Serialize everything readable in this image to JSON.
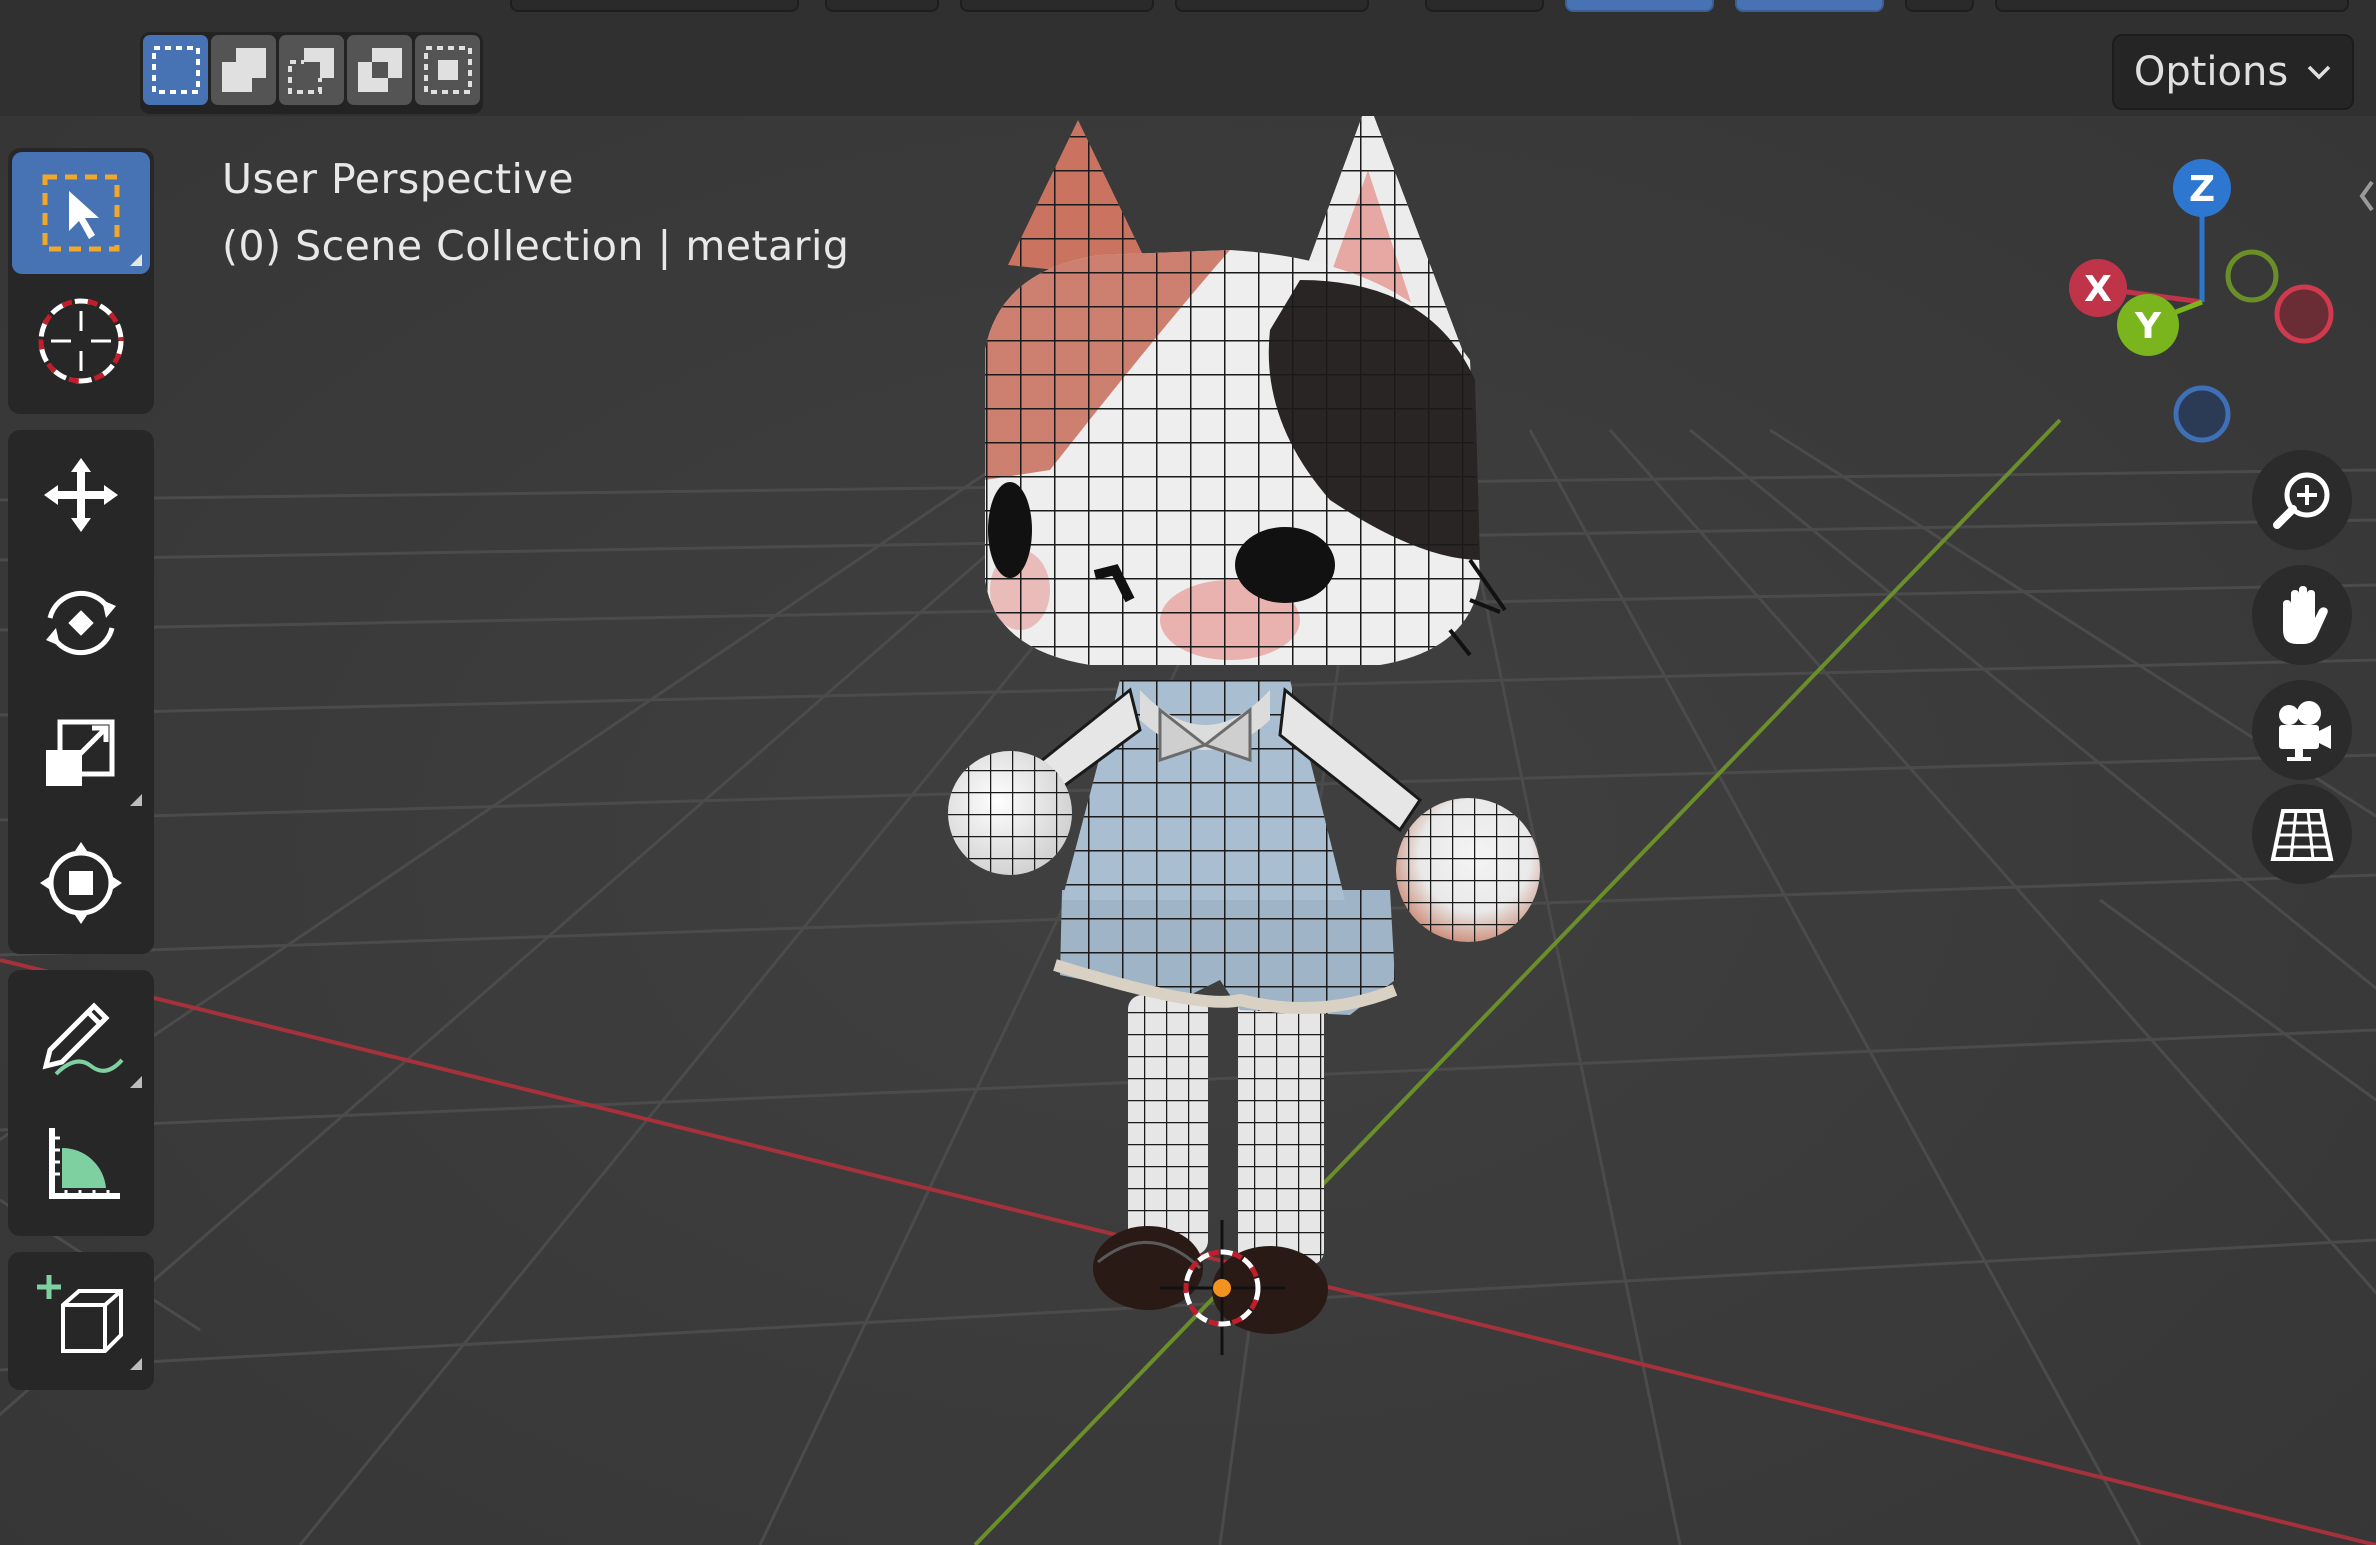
{
  "viewport": {
    "overlay_line1": "User Perspective",
    "overlay_line2": "(0) Scene Collection | metarig",
    "options_label": "Options",
    "background_color": "#3d3d3d",
    "grid_color": "#4a4a4a",
    "x_axis_color": "#a5313b",
    "y_axis_color": "#6a8f2a"
  },
  "select_modes": [
    {
      "name": "new-selection-icon",
      "active": true
    },
    {
      "name": "extend-selection-icon",
      "active": false
    },
    {
      "name": "subtract-selection-icon",
      "active": false
    },
    {
      "name": "invert-selection-icon",
      "active": false
    },
    {
      "name": "intersect-selection-icon",
      "active": false
    }
  ],
  "tools": [
    {
      "name": "select-box-icon",
      "active": true
    },
    {
      "name": "cursor-icon",
      "active": false
    },
    {
      "name": "move-icon",
      "active": false
    },
    {
      "name": "rotate-icon",
      "active": false
    },
    {
      "name": "scale-icon",
      "active": false
    },
    {
      "name": "transform-icon",
      "active": false
    },
    {
      "name": "annotate-icon",
      "active": false
    },
    {
      "name": "measure-icon",
      "active": false
    },
    {
      "name": "add-cube-icon",
      "active": false
    }
  ],
  "gizmo": {
    "z_label": "Z",
    "x_label": "X",
    "y_label": "Y",
    "z_color": "#2e77d0",
    "x_color": "#c0344a",
    "y_color": "#7ab51d"
  },
  "nav_buttons": [
    {
      "name": "zoom-icon"
    },
    {
      "name": "pan-hand-icon"
    },
    {
      "name": "camera-icon"
    },
    {
      "name": "ortho-grid-icon"
    }
  ],
  "accent_color": "#4772b3"
}
